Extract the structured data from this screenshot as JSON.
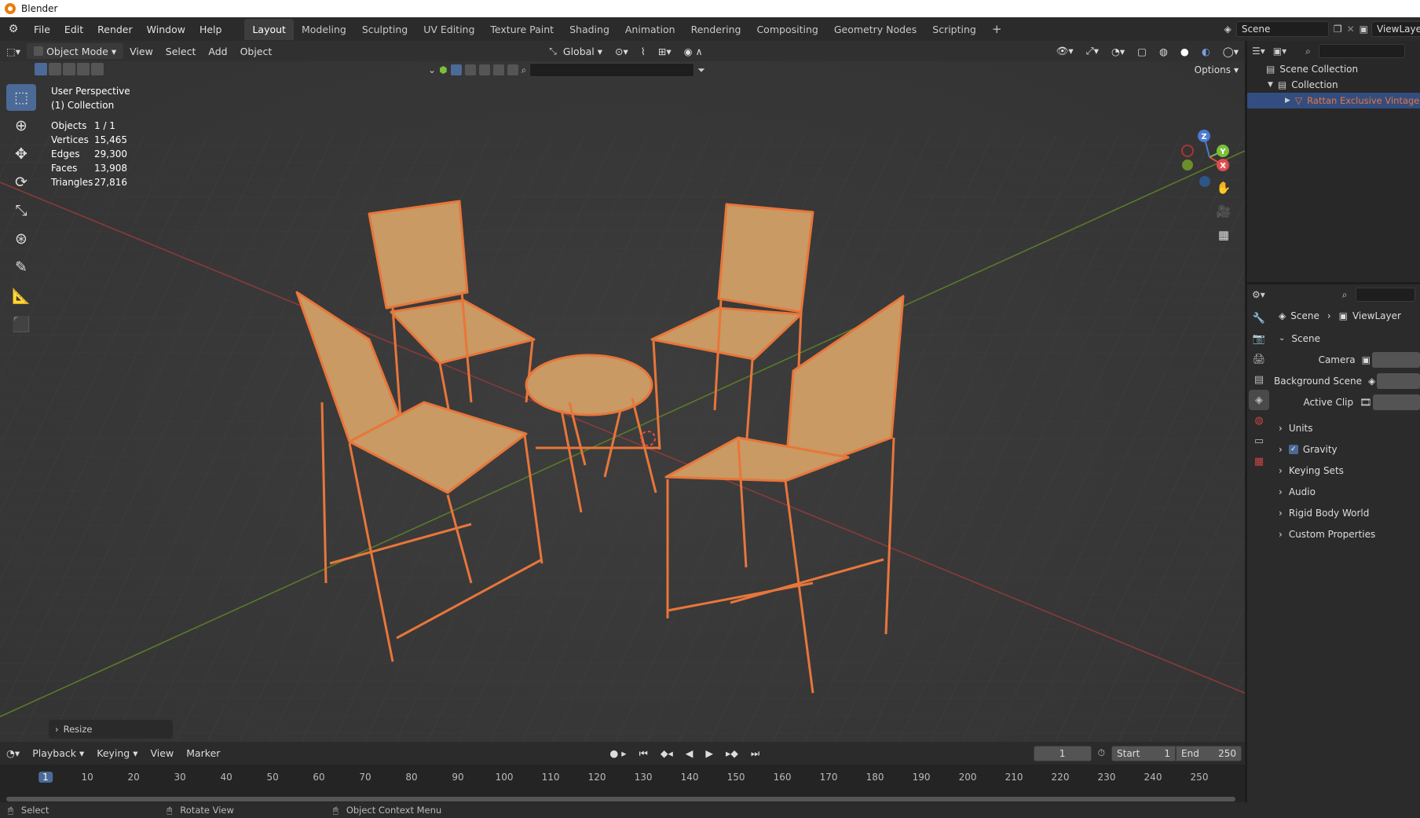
{
  "window": {
    "title": "Blender"
  },
  "menus": [
    "File",
    "Edit",
    "Render",
    "Window",
    "Help"
  ],
  "workspaces": [
    "Layout",
    "Modeling",
    "Sculpting",
    "UV Editing",
    "Texture Paint",
    "Shading",
    "Animation",
    "Rendering",
    "Compositing",
    "Geometry Nodes",
    "Scripting"
  ],
  "active_workspace": "Layout",
  "scene_field": "Scene",
  "viewlayer_field": "ViewLaye",
  "viewport_header": {
    "mode": "Object Mode",
    "menus": [
      "View",
      "Select",
      "Add",
      "Object"
    ],
    "orientation": "Global",
    "options": "Options"
  },
  "overlay_text": {
    "perspective": "User Perspective",
    "collection": "(1) Collection",
    "stats": [
      {
        "key": "Objects",
        "value": "1 / 1"
      },
      {
        "key": "Vertices",
        "value": "15,465"
      },
      {
        "key": "Edges",
        "value": "29,300"
      },
      {
        "key": "Faces",
        "value": "13,908"
      },
      {
        "key": "Triangles",
        "value": "27,816"
      }
    ]
  },
  "gizmo": {
    "x": "X",
    "y": "Y",
    "z": "Z"
  },
  "last_operator": "Resize",
  "timeline": {
    "menus": [
      "Playback",
      "Keying",
      "View",
      "Marker"
    ],
    "current_frame": "1",
    "start_label": "Start",
    "start_value": "1",
    "end_label": "End",
    "end_value": "250",
    "ticks": [
      "1",
      "10",
      "20",
      "30",
      "40",
      "50",
      "60",
      "70",
      "80",
      "90",
      "100",
      "110",
      "120",
      "130",
      "140",
      "150",
      "160",
      "170",
      "180",
      "190",
      "200",
      "210",
      "220",
      "230",
      "240",
      "250"
    ]
  },
  "statusbar": {
    "left": "Select",
    "middle": "Rotate View",
    "right": "Object Context Menu"
  },
  "outliner": {
    "root": "Scene Collection",
    "collection": "Collection",
    "object": "Rattan Exclusive Vintage Se",
    "object_color": "#e8763a"
  },
  "properties": {
    "breadcrumb_scene": "Scene",
    "breadcrumb_viewlayer": "ViewLayer",
    "panel_title": "Scene",
    "fields": [
      {
        "label": "Camera"
      },
      {
        "label": "Background Scene"
      },
      {
        "label": "Active Clip"
      }
    ],
    "sections": [
      {
        "label": "Units",
        "checkbox": false
      },
      {
        "label": "Gravity",
        "checkbox": true
      },
      {
        "label": "Keying Sets",
        "checkbox": false
      },
      {
        "label": "Audio",
        "checkbox": false
      },
      {
        "label": "Rigid Body World",
        "checkbox": false
      },
      {
        "label": "Custom Properties",
        "checkbox": false
      }
    ]
  },
  "colors": {
    "accent": "#4b6a97",
    "selection_outline": "#e8763a",
    "rattan": "#c99a63"
  }
}
